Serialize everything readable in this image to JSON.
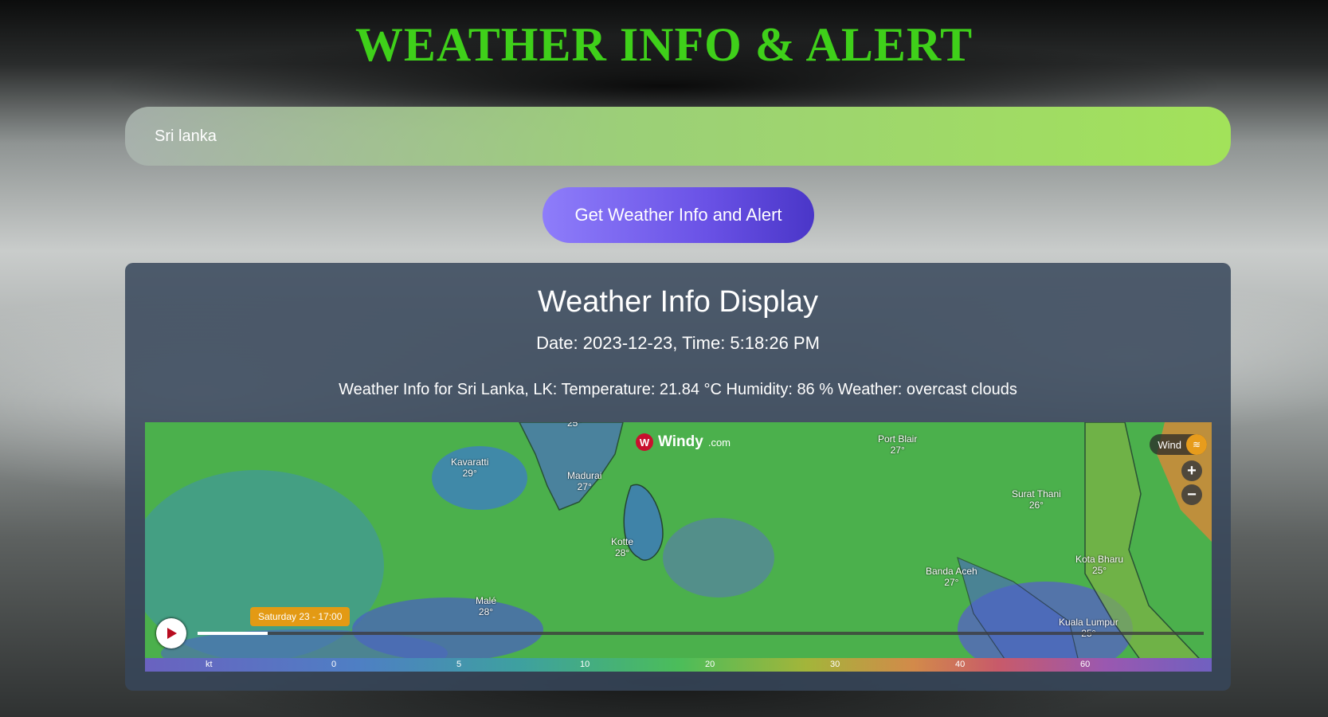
{
  "header": {
    "title": "WEATHER INFO & ALERT"
  },
  "search": {
    "value": "Sri lanka"
  },
  "action": {
    "button_label": "Get Weather Info and Alert"
  },
  "panel": {
    "heading": "Weather Info Display",
    "datetime": "Date: 2023-12-23, Time: 5:18:26 PM",
    "info": "Weather Info for Sri Lanka, LK: Temperature: 21.84 °C Humidity: 86 % Weather: overcast clouds"
  },
  "map": {
    "brand": "Windy",
    "brand_suffix": ".com",
    "layer_label": "Wind",
    "time_badge": "Saturday 23 - 17:00",
    "timeline_progress": 0.07,
    "cities": [
      {
        "name": "Kavaratti",
        "temp": "29°"
      },
      {
        "name": "Madurai",
        "temp": "27°"
      },
      {
        "name": "Kotte",
        "temp": "28°"
      },
      {
        "name": "Malé",
        "temp": "28°"
      },
      {
        "name": "Port Blair",
        "temp": "27°"
      },
      {
        "name": "Surat Thani",
        "temp": "26°"
      },
      {
        "name": "Kota Bharu",
        "temp": "25°"
      },
      {
        "name": "Banda Aceh",
        "temp": "27°"
      },
      {
        "name": "Kuala Lumpur",
        "temp": "25°"
      },
      {
        "name": "",
        "temp": "25°"
      }
    ],
    "legend": [
      "kt",
      "0",
      "5",
      "10",
      "20",
      "30",
      "40",
      "60"
    ]
  }
}
